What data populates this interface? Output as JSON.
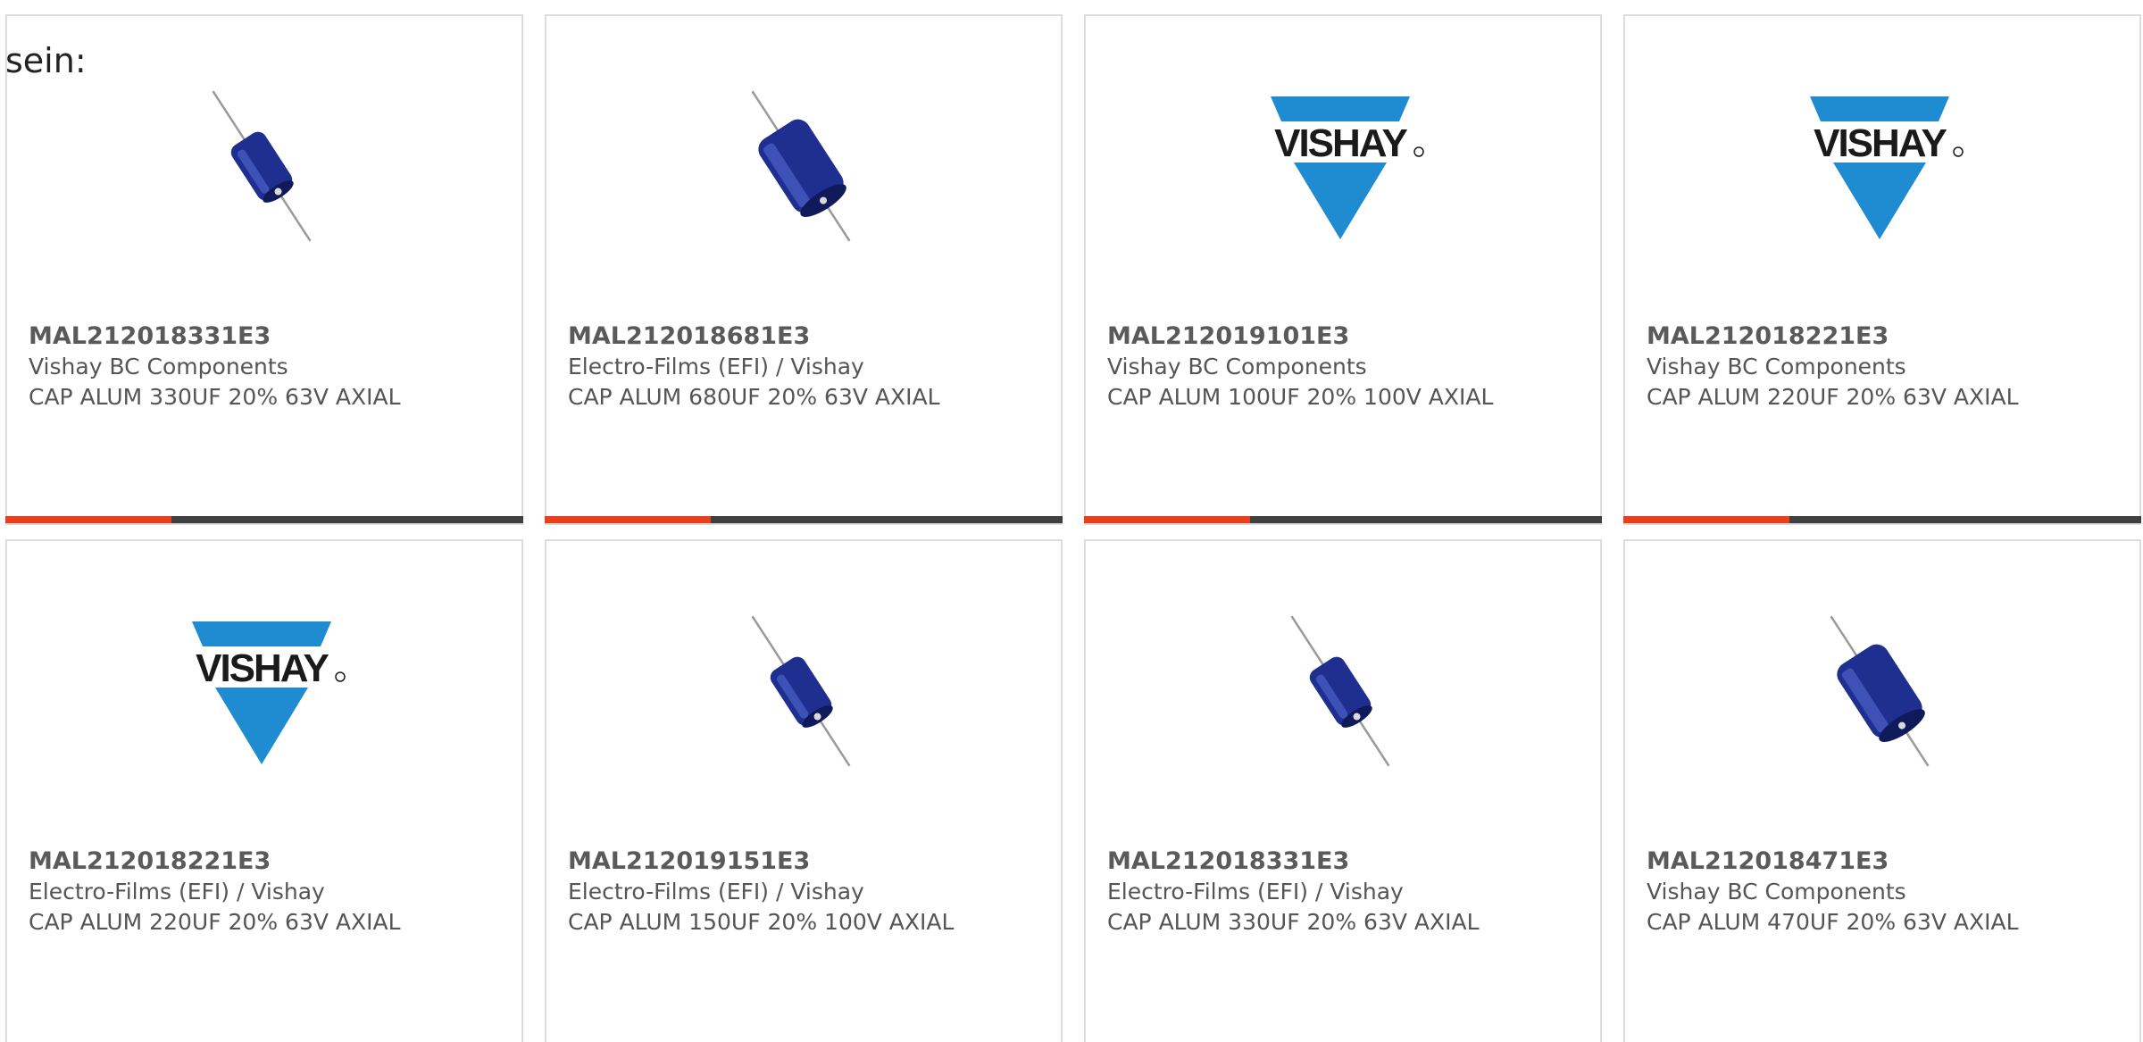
{
  "intro_text": "sein:",
  "colors": {
    "accent": "#e8401c",
    "progress_track": "#3f3f3f",
    "capacitor_body": "#1e2f8f",
    "vishay_blue": "#1f8bd1"
  },
  "cards": [
    {
      "part_number": "MAL212018331E3",
      "manufacturer": "Vishay BC Components",
      "description": "CAP ALUM 330UF 20% 63V AXIAL",
      "image": "capacitor-small",
      "progress": 0.32
    },
    {
      "part_number": "MAL212018681E3",
      "manufacturer": "Electro-Films (EFI) / Vishay",
      "description": "CAP ALUM 680UF 20% 63V AXIAL",
      "image": "capacitor-large",
      "progress": 0.32
    },
    {
      "part_number": "MAL212019101E3",
      "manufacturer": "Vishay BC Components",
      "description": "CAP ALUM 100UF 20% 100V AXIAL",
      "image": "vishay-logo",
      "progress": 0.32
    },
    {
      "part_number": "MAL212018221E3",
      "manufacturer": "Vishay BC Components",
      "description": "CAP ALUM 220UF 20% 63V AXIAL",
      "image": "vishay-logo",
      "progress": 0.32
    },
    {
      "part_number": "MAL212018221E3",
      "manufacturer": "Electro-Films (EFI) / Vishay",
      "description": "CAP ALUM 220UF 20% 63V AXIAL",
      "image": "vishay-logo",
      "progress": null
    },
    {
      "part_number": "MAL212019151E3",
      "manufacturer": "Electro-Films (EFI) / Vishay",
      "description": "CAP ALUM 150UF 20% 100V AXIAL",
      "image": "capacitor-small",
      "progress": null
    },
    {
      "part_number": "MAL212018331E3",
      "manufacturer": "Electro-Films (EFI) / Vishay",
      "description": "CAP ALUM 330UF 20% 63V AXIAL",
      "image": "capacitor-small",
      "progress": null
    },
    {
      "part_number": "MAL212018471E3",
      "manufacturer": "Vishay BC Components",
      "description": "CAP ALUM 470UF 20% 63V AXIAL",
      "image": "capacitor-large",
      "progress": null
    }
  ]
}
